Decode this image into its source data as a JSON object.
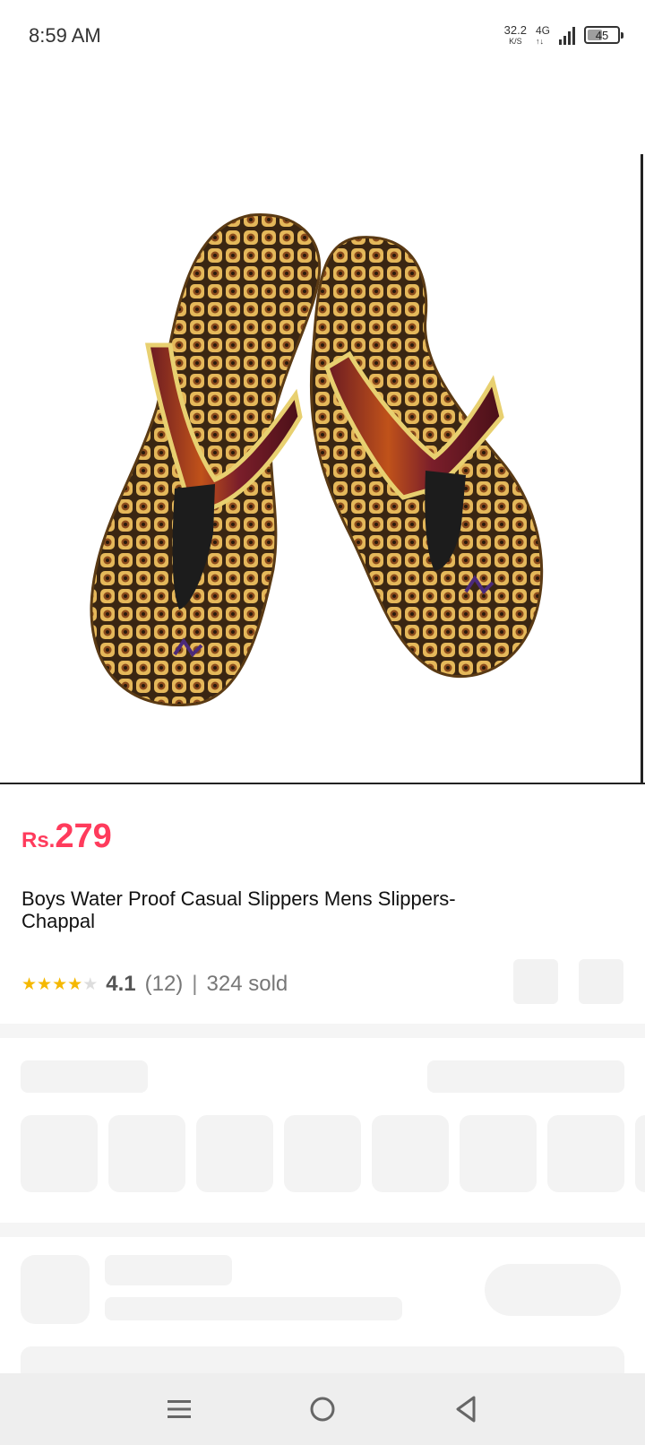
{
  "status_bar": {
    "time": "8:59 AM",
    "net_speed_value": "32.2",
    "net_speed_unit": "K/S",
    "network_type": "4G",
    "network_arrows": "↑↓",
    "battery": "45"
  },
  "product": {
    "currency": "Rs.",
    "price": "279",
    "title": "Boys Water Proof Casual Slippers Mens Slippers-Chappal",
    "rating": "4.1",
    "rating_stars": 4.1,
    "review_count": "(12)",
    "separator": "|",
    "sold": "324 sold"
  },
  "colors": {
    "price": "#ff3b5c",
    "star": "#f5b800",
    "placeholder": "#f3f3f3"
  },
  "icons": {
    "nav_menu": "menu-icon",
    "nav_home": "home-circle-icon",
    "nav_back": "back-triangle-icon"
  }
}
